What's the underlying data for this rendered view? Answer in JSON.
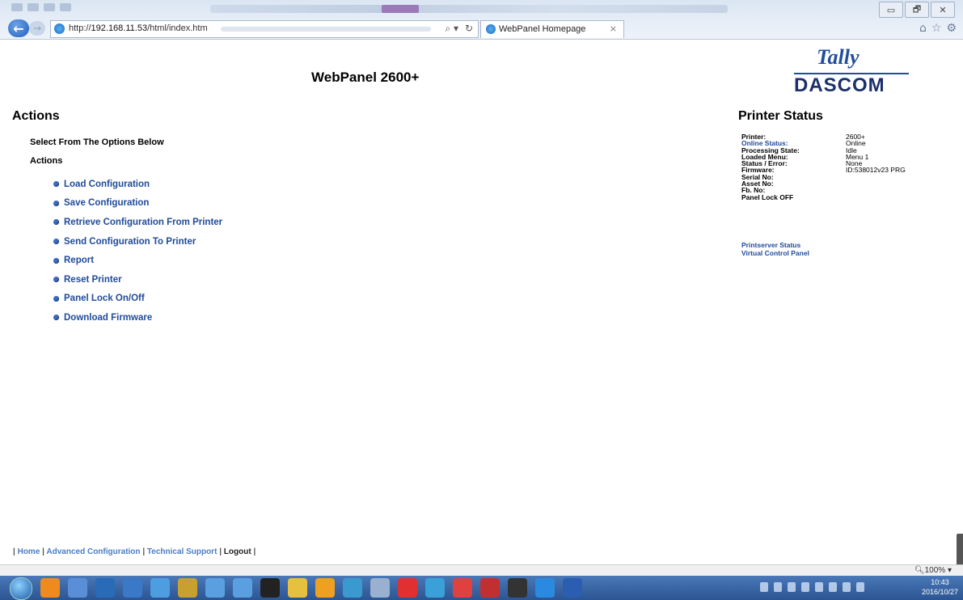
{
  "browser": {
    "url_prefix": "http://",
    "url_host": "192.168.11.53",
    "url_path": "/html/index.htm",
    "tab_title": "WebPanel Homepage",
    "zoom": "100%",
    "window_controls": [
      "▭",
      "🗗",
      "✕"
    ]
  },
  "page": {
    "title": "WebPanel 2600+",
    "logo": {
      "line1": "Tally",
      "line2": "DASCOM"
    }
  },
  "actions": {
    "heading": "Actions",
    "select_label": "Select From The Options Below",
    "sub_heading": "Actions",
    "items": [
      "Load Configuration",
      "Save Configuration",
      "Retrieve Configuration From Printer",
      "Send Configuration To Printer",
      "Report",
      "Reset Printer",
      "Panel Lock On/Off",
      "Download Firmware"
    ]
  },
  "status": {
    "heading": "Printer Status",
    "rows": [
      {
        "key": "Printer:",
        "value": "2600+"
      },
      {
        "key": "Online Status:",
        "value": "Online"
      },
      {
        "key": "Processing State:",
        "value": "Idle"
      },
      {
        "key": "Loaded Menu:",
        "value": "Menu 1"
      },
      {
        "key": "Status / Error:",
        "value": "None"
      },
      {
        "key": "Firmware:",
        "value": "ID:538012v23 PRG"
      },
      {
        "key": "Serial No:",
        "value": ""
      },
      {
        "key": "Asset No:",
        "value": ""
      },
      {
        "key": "Fb. No:",
        "value": ""
      },
      {
        "key": "Panel Lock OFF",
        "value": ""
      }
    ],
    "links": [
      "Printserver Status",
      "Virtual Control Panel"
    ]
  },
  "footer": {
    "links": [
      "Home",
      "Advanced Configuration",
      "Technical Support",
      "Logout"
    ],
    "separator": "|"
  },
  "taskbar": {
    "time": "10:43",
    "date": "2016/10/27",
    "icon_colors": [
      "#f08a1c",
      "#5a8fd8",
      "#2a6bb8",
      "#3a78c8",
      "#4d9ee0",
      "#c8a030",
      "#5aa0e0",
      "#5aa0e0",
      "#222",
      "#e8c040",
      "#f0a020",
      "#3a9ad0",
      "#9ab0d0",
      "#e03030",
      "#3aa0d8",
      "#e04040",
      "#c03030",
      "#333",
      "#2a8ae0",
      "#2b5eb0"
    ]
  }
}
